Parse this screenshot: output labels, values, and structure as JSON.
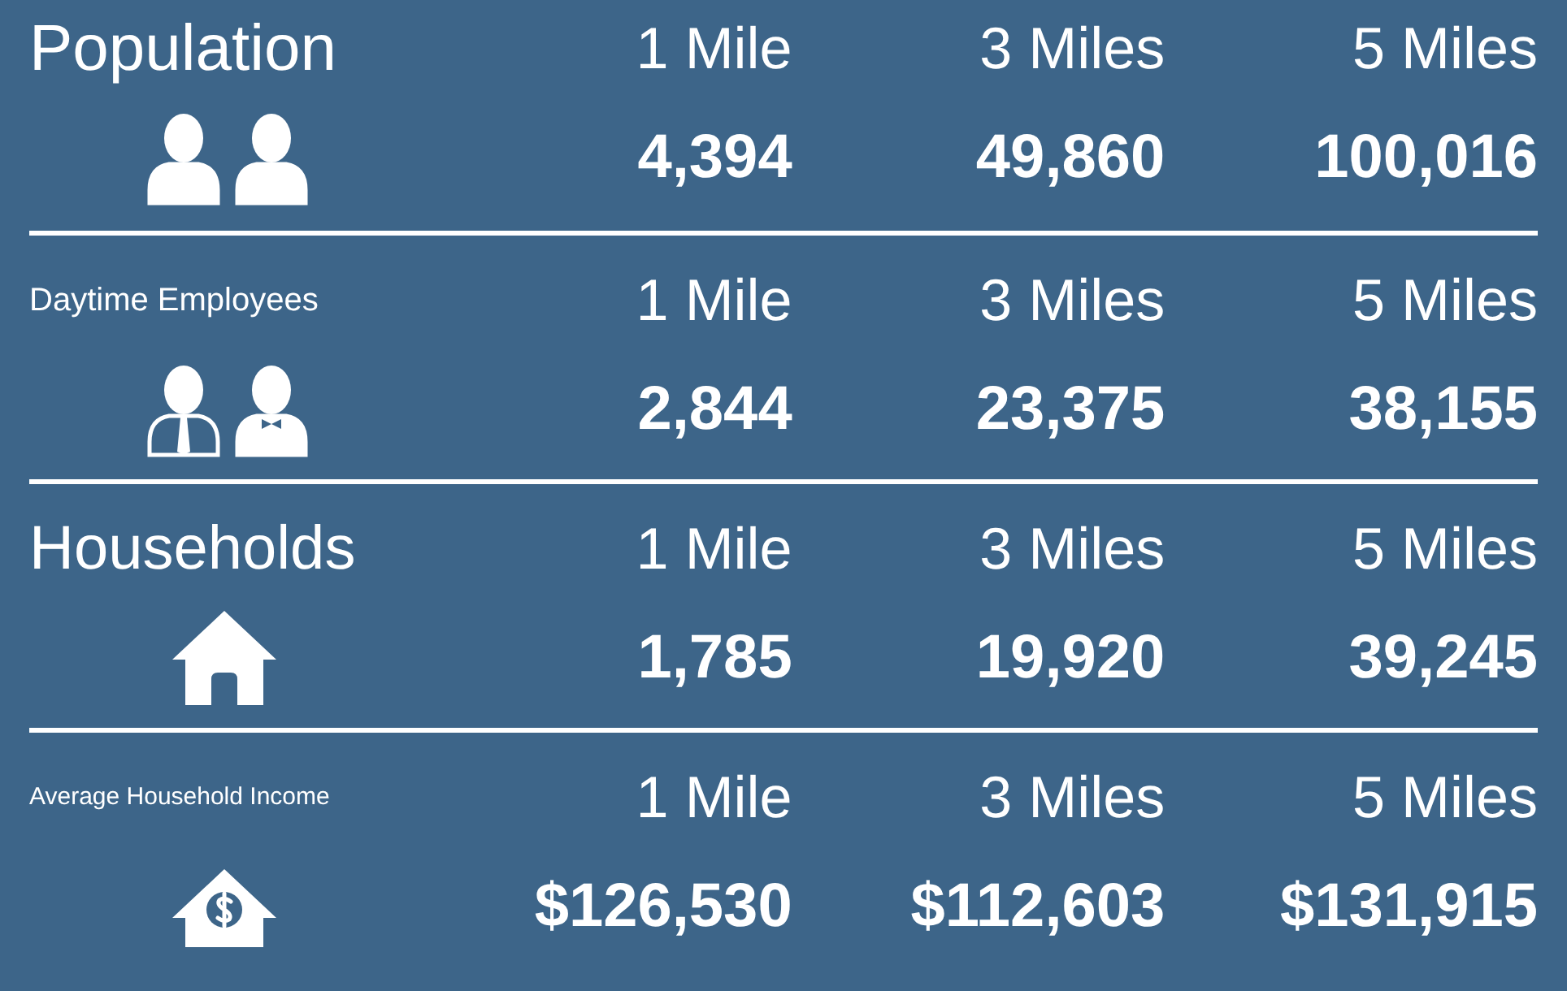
{
  "sections": [
    {
      "kind": "population",
      "label": "Population",
      "columns": [
        {
          "header": "1 Mile",
          "value": "4,394"
        },
        {
          "header": "3 Miles",
          "value": "49,860"
        },
        {
          "header": "5 Miles",
          "value": "100,016"
        }
      ]
    },
    {
      "kind": "employees",
      "label": "Daytime Employees",
      "columns": [
        {
          "header": "1 Mile",
          "value": "2,844"
        },
        {
          "header": "3 Miles",
          "value": "23,375"
        },
        {
          "header": "5 Miles",
          "value": "38,155"
        }
      ]
    },
    {
      "kind": "households",
      "label": "Households",
      "columns": [
        {
          "header": "1 Mile",
          "value": "1,785"
        },
        {
          "header": "3 Miles",
          "value": "19,920"
        },
        {
          "header": "5 Miles",
          "value": "39,245"
        }
      ]
    },
    {
      "kind": "income",
      "label": "Average Household Income",
      "columns": [
        {
          "header": "1 Mile",
          "value": "$126,530"
        },
        {
          "header": "3 Miles",
          "value": "$112,603"
        },
        {
          "header": "5 Miles",
          "value": "$131,915"
        }
      ]
    }
  ]
}
